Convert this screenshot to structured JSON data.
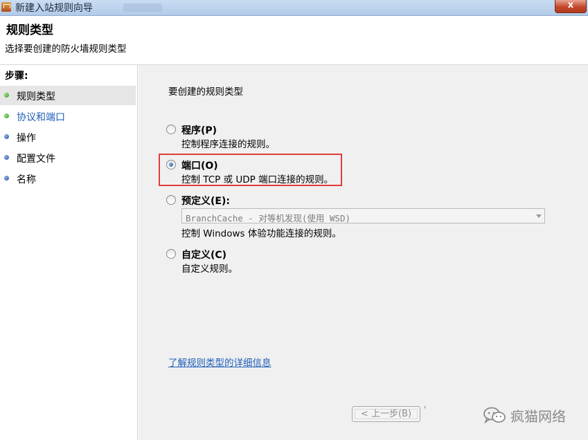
{
  "window": {
    "title": "新建入站规则向导",
    "close_label": "x"
  },
  "header": {
    "title": "规则类型",
    "subtitle": "选择要创建的防火墙规则类型"
  },
  "steps": {
    "title": "步骤:",
    "items": [
      {
        "label": "规则类型",
        "state": "current",
        "dot_color": "#2f9a1f"
      },
      {
        "label": "协议和端口",
        "state": "link",
        "dot_color": "#2f9a1f"
      },
      {
        "label": "操作",
        "state": "pending",
        "dot_color": "#2d4fa6"
      },
      {
        "label": "配置文件",
        "state": "pending",
        "dot_color": "#2d4fa6"
      },
      {
        "label": "名称",
        "state": "pending",
        "dot_color": "#2d4fa6"
      }
    ]
  },
  "main": {
    "question": "要创建的规则类型",
    "options": [
      {
        "label": "程序(P)",
        "description": "控制程序连接的规则。",
        "checked": false
      },
      {
        "label": "端口(O)",
        "description": "控制 TCP 或 UDP 端口连接的规则。",
        "checked": true
      },
      {
        "label": "预定义(E):",
        "description": "控制 Windows 体验功能连接的规则。",
        "checked": false
      },
      {
        "label": "自定义(C)",
        "description": "自定义规则。",
        "checked": false
      }
    ],
    "predefined_select": {
      "value": "BranchCache - 对等机发现(使用 WSD)",
      "enabled": false
    },
    "learn_more_link": "了解规则类型的详细信息",
    "prev_button": "< 上一步(B)",
    "highlight_color": "#e23b3b"
  },
  "watermark": {
    "text": "疯猫网络"
  }
}
